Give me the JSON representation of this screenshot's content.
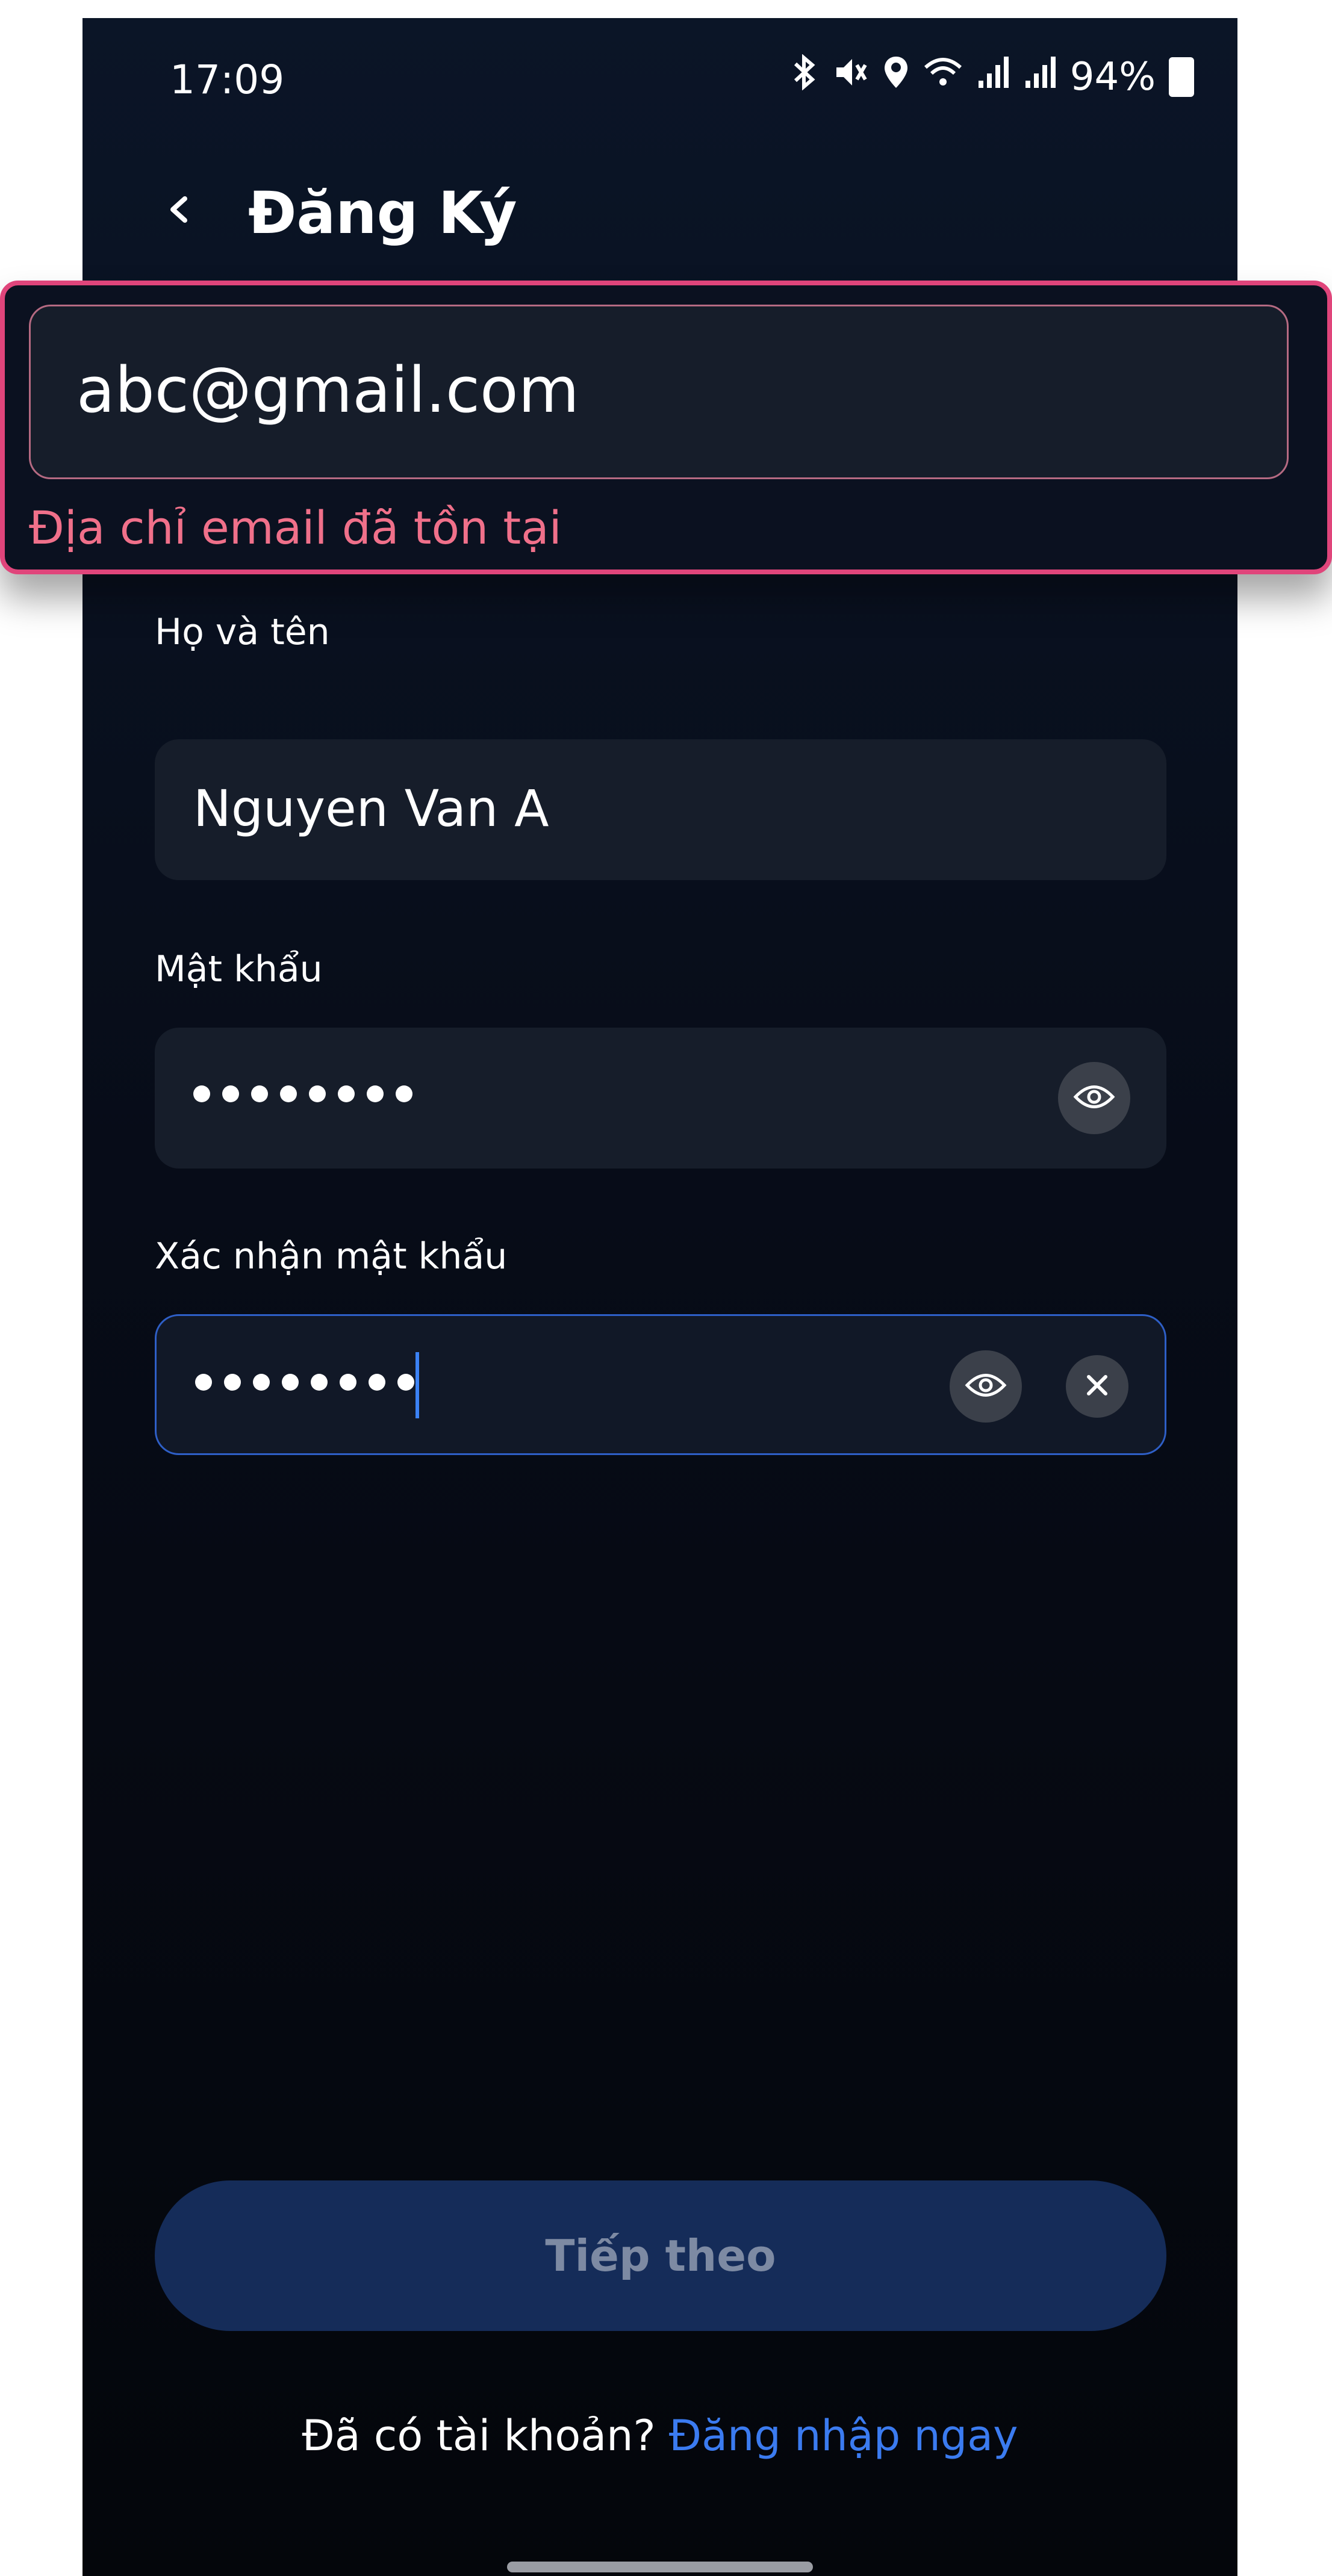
{
  "status_bar": {
    "time": "17:09",
    "battery": "94%",
    "icons": [
      "bluetooth-icon",
      "mute-icon",
      "location-icon",
      "wifi-icon",
      "signal-icon",
      "signal-icon",
      "battery-icon"
    ]
  },
  "header": {
    "back_icon": "chevron-left-icon",
    "title": "Đăng Ký"
  },
  "email": {
    "value": "abc@gmail.com",
    "error": "Địa chỉ email đã tồn tại"
  },
  "full_name": {
    "label": "Họ và tên",
    "value": "Nguyen Van A"
  },
  "password": {
    "label": "Mật khẩu",
    "masked_length": 8,
    "toggle_icon": "eye-icon"
  },
  "confirm_password": {
    "label": "Xác nhận mật khẩu",
    "masked_length": 8,
    "toggle_icon": "eye-icon",
    "clear_icon": "close-icon"
  },
  "submit": {
    "label": "Tiếp theo"
  },
  "login_prompt": {
    "text": "Đã có tài khoản? ",
    "link": "Đăng nhập ngay"
  },
  "colors": {
    "accent": "#3b7bf0",
    "error": "#f0708a",
    "callout_border": "#e0457b",
    "button_bg": "#152c59"
  }
}
